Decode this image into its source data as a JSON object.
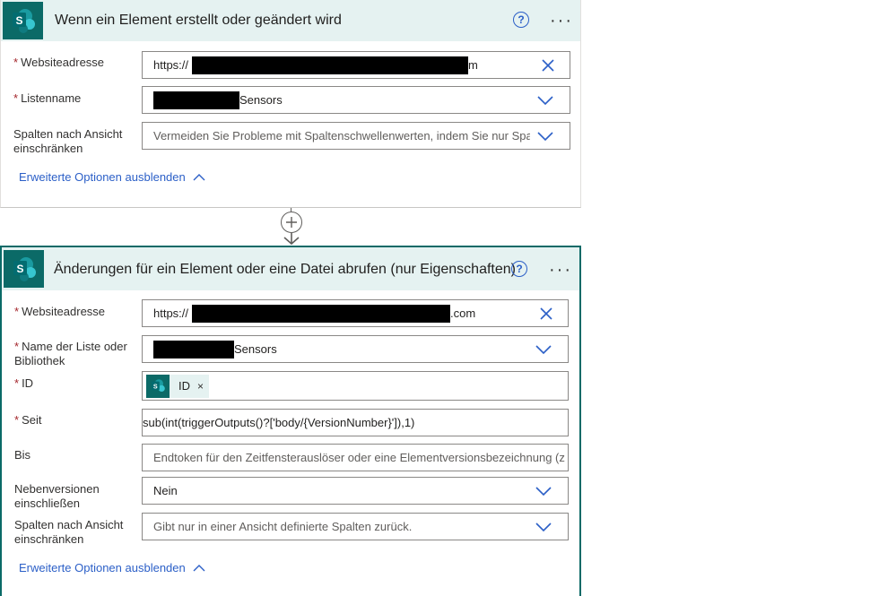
{
  "trigger": {
    "title": "Wenn ein Element erstellt oder geändert wird",
    "fields": {
      "site_label": "Websiteadresse",
      "site_prefix": "https://",
      "site_suffix": "m",
      "list_label": "Listenname",
      "list_suffix": "Sensors",
      "view_label_1": "Spalten nach Ansicht",
      "view_label_2": "einschränken",
      "view_placeholder": "Vermeiden Sie Probleme mit Spaltenschwellenwerten, indem Sie nur Spal"
    },
    "advanced_link": "Erweiterte Optionen ausblenden"
  },
  "action": {
    "title": "Änderungen für ein Element oder eine Datei abrufen (nur Eigenschaften)",
    "fields": {
      "site_label": "Websiteadresse",
      "site_prefix": "https://",
      "site_suffix": ".com",
      "list_label_1": "Name der Liste oder",
      "list_label_2": "Bibliothek",
      "list_suffix": "Sensors",
      "id_label": "ID",
      "id_token": "ID",
      "since_label": "Seit",
      "since_value": "sub(int(triggerOutputs()?['body/{VersionNumber}']),1)",
      "until_label": "Bis",
      "until_placeholder": "Endtoken für den Zeitfensterauslöser oder eine Elementversionsbezeichnung (z",
      "minor_label_1": "Nebenversionen",
      "minor_label_2": "einschließen",
      "minor_value": "Nein",
      "view_label_1": "Spalten nach Ansicht",
      "view_label_2": "einschränken",
      "view_placeholder": "Gibt nur in einer Ansicht definierte Spalten zurück."
    },
    "advanced_link": "Erweiterte Optionen ausblenden"
  },
  "required_mark": "*",
  "token_remove": "×",
  "colors": {
    "accent": "#0b6a67",
    "header_bg": "#e5f2f1",
    "link": "#2b5fc7",
    "required": "#a4262c"
  }
}
